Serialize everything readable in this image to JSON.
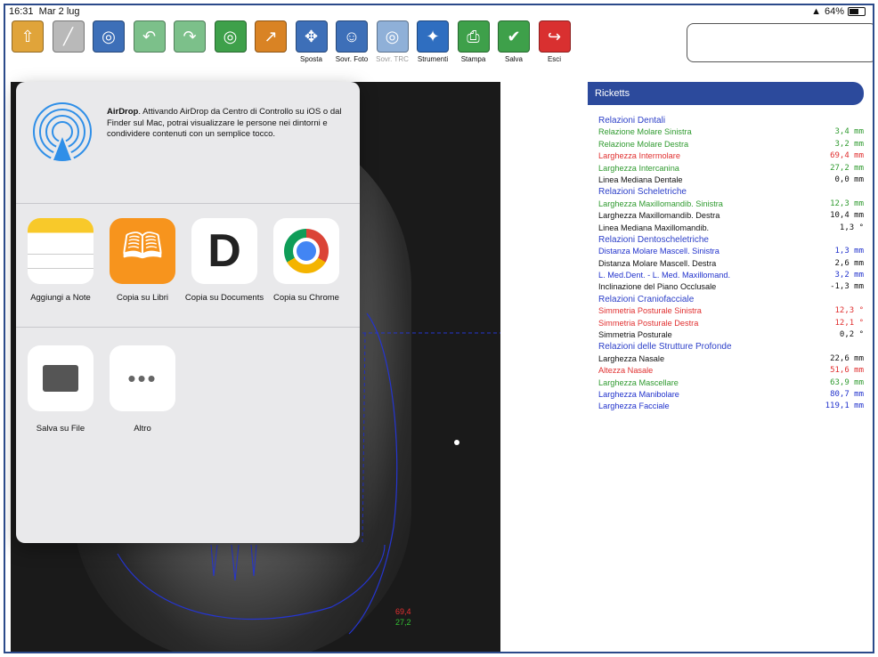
{
  "status": {
    "time": "16:31",
    "date": "Mar 2 lug",
    "battery": "64%"
  },
  "toolbar": {
    "buttons": [
      {
        "label": "",
        "icon": "upload-icon",
        "color": "#e0a43a"
      },
      {
        "label": "",
        "icon": "calibrate-icon",
        "color": "#b9b9b9"
      },
      {
        "label": "",
        "icon": "landmark-icon",
        "color": "#3d6fb8"
      },
      {
        "label": "",
        "icon": "undo-icon",
        "color": "#7cc08a"
      },
      {
        "label": "",
        "icon": "redo-icon",
        "color": "#7cc08a"
      },
      {
        "label": "",
        "icon": "tracing-icon",
        "color": "#3ea04a"
      },
      {
        "label": "",
        "icon": "move-point-icon",
        "color": "#d98324"
      },
      {
        "label": "Sposta",
        "icon": "move-icon",
        "color": "#3d6fb8"
      },
      {
        "label": "Sovr. Foto",
        "icon": "photo-overlay-icon",
        "color": "#3d6fb8"
      },
      {
        "label": "Sovr. TRC",
        "icon": "trc-overlay-icon",
        "color": "#8fb0d8"
      },
      {
        "label": "Strumenti",
        "icon": "tools-icon",
        "color": "#2f6ec0"
      },
      {
        "label": "Stampa",
        "icon": "print-icon",
        "color": "#3ea04a"
      },
      {
        "label": "Salva",
        "icon": "save-check-icon",
        "color": "#3ea04a"
      },
      {
        "label": "Esci",
        "icon": "exit-icon",
        "color": "#d93030"
      }
    ]
  },
  "xray": {
    "meas_red": "69,4",
    "meas_green": "27,2"
  },
  "share": {
    "airdrop_title": "AirDrop",
    "airdrop_text": ". Attivando AirDrop da Centro di Controllo su iOS o dal Finder sul Mac, potrai visualizzare le persone nei dintorni e condividere contenuti con un semplice tocco.",
    "apps": [
      {
        "name": "Aggiungi a Note",
        "icon": "notes-icon"
      },
      {
        "name": "Copia su Libri",
        "icon": "books-icon"
      },
      {
        "name": "Copia su Documents",
        "icon": "documents-icon"
      },
      {
        "name": "Copia su Chrome",
        "icon": "chrome-icon"
      }
    ],
    "actions": [
      {
        "name": "Salva su File",
        "icon": "folder-icon"
      },
      {
        "name": "Altro",
        "icon": "more-icon"
      }
    ]
  },
  "panel": {
    "title": "Ricketts",
    "rows": [
      {
        "type": "section",
        "label": "Relazioni Dentali",
        "value": ""
      },
      {
        "type": "row",
        "label": "Relazione Molare Sinistra",
        "value": "3,4 mm",
        "color": "green"
      },
      {
        "type": "row",
        "label": "Relazione Molare Destra",
        "value": "3,2 mm",
        "color": "green"
      },
      {
        "type": "row",
        "label": "Larghezza Intermolare",
        "value": "69,4 mm",
        "color": "red"
      },
      {
        "type": "row",
        "label": "Larghezza Intercanina",
        "value": "27,2 mm",
        "color": "green"
      },
      {
        "type": "row",
        "label": "Linea Mediana Dentale",
        "value": "0,0 mm",
        "color": "black"
      },
      {
        "type": "section",
        "label": "Relazioni Scheletriche",
        "value": ""
      },
      {
        "type": "row",
        "label": "Larghezza Maxillomandib. Sinistra",
        "value": "12,3 mm",
        "color": "green"
      },
      {
        "type": "row",
        "label": "Larghezza Maxillomandib. Destra",
        "value": "10,4 mm",
        "color": "black"
      },
      {
        "type": "row",
        "label": "Linea Mediana Maxillomandib.",
        "value": "1,3 °",
        "color": "black"
      },
      {
        "type": "section",
        "label": "Relazioni Dentoscheletriche",
        "value": ""
      },
      {
        "type": "row",
        "label": "Distanza Molare Mascell. Sinistra",
        "value": "1,3 mm",
        "color": "blue"
      },
      {
        "type": "row",
        "label": "Distanza Molare Mascell. Destra",
        "value": "2,6 mm",
        "color": "black"
      },
      {
        "type": "row",
        "label": "L. Med.Dent. - L. Med. Maxillomand.",
        "value": "3,2 mm",
        "color": "blue"
      },
      {
        "type": "row",
        "label": "Inclinazione del Piano Occlusale",
        "value": "-1,3 mm",
        "color": "black"
      },
      {
        "type": "section",
        "label": "Relazioni Craniofacciale",
        "value": ""
      },
      {
        "type": "row",
        "label": "Simmetria Posturale Sinistra",
        "value": "12,3 °",
        "color": "red"
      },
      {
        "type": "row",
        "label": "Simmetria Posturale Destra",
        "value": "12,1 °",
        "color": "red"
      },
      {
        "type": "row",
        "label": "Simmetria Posturale",
        "value": "0,2 °",
        "color": "black"
      },
      {
        "type": "section",
        "label": "Relazioni delle Strutture Profonde",
        "value": ""
      },
      {
        "type": "row",
        "label": "Larghezza Nasale",
        "value": "22,6 mm",
        "color": "black"
      },
      {
        "type": "row",
        "label": "Altezza Nasale",
        "value": "51,6 mm",
        "color": "red"
      },
      {
        "type": "row",
        "label": "Larghezza Mascellare",
        "value": "63,9 mm",
        "color": "green"
      },
      {
        "type": "row",
        "label": "Larghezza Manibolare",
        "value": "80,7 mm",
        "color": "blue"
      },
      {
        "type": "row",
        "label": "Larghezza Facciale",
        "value": "119,1 mm",
        "color": "blue"
      }
    ]
  },
  "colors": {
    "accent": "#2c4a9c",
    "green": "#2f9a2f",
    "red": "#e03030",
    "blue": "#2233cc"
  }
}
